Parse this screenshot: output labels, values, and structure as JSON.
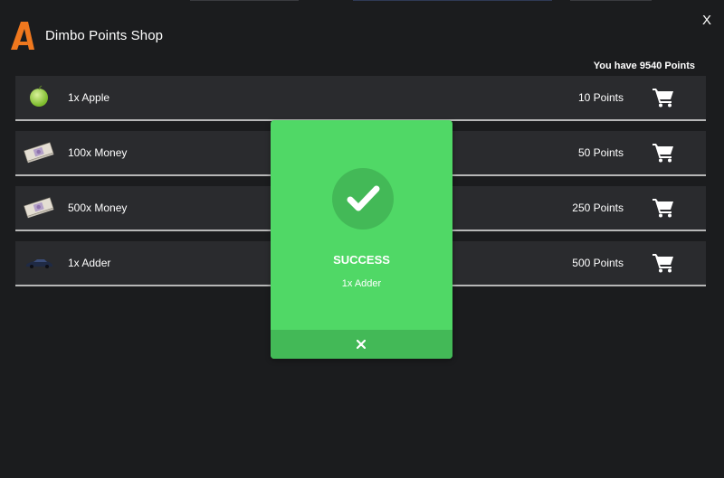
{
  "app": {
    "title": "Dimbo Points Shop",
    "close_label": "X",
    "balance_text": "You have 9540 Points"
  },
  "items": [
    {
      "name": "1x Apple",
      "price": "10 Points",
      "icon": "apple-icon"
    },
    {
      "name": "100x Money",
      "price": "50 Points",
      "icon": "money-icon"
    },
    {
      "name": "500x Money",
      "price": "250 Points",
      "icon": "money-icon"
    },
    {
      "name": "1x Adder",
      "price": "500 Points",
      "icon": "car-icon"
    }
  ],
  "modal": {
    "title": "SUCCESS",
    "item": "1x Adder",
    "icon": "checkmark-icon",
    "close_icon": "close-icon"
  },
  "colors": {
    "background": "#1b1c1e",
    "row_background": "#2a2b2e",
    "row_border": "#b7b7b7",
    "logo_orange": "#f0781e",
    "success_green": "#50d866",
    "success_green_dark": "#43b957"
  }
}
